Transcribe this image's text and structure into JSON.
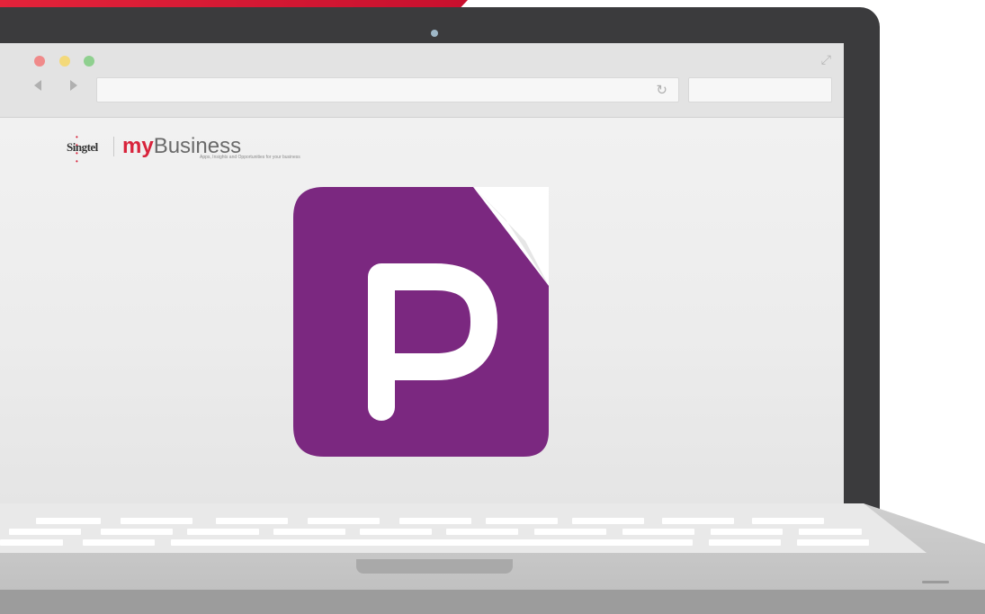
{
  "window": {
    "traffic_lights": [
      "close",
      "minimize",
      "zoom"
    ],
    "icons": {
      "back": "chevron-left-icon",
      "forward": "chevron-right-icon",
      "reload": "reload-icon",
      "expand": "expand-icon"
    },
    "address_value": "",
    "search_value": ""
  },
  "page": {
    "brand_name": "Singtel",
    "title_my": "my",
    "title_business": "Business",
    "tagline": "Apps, Insights and Opportunities for your business"
  },
  "app_icon": {
    "letter": "P",
    "color": "#7b2880"
  },
  "colors": {
    "brand_red": "#d8233b",
    "laptop_frame": "#3b3b3d"
  }
}
